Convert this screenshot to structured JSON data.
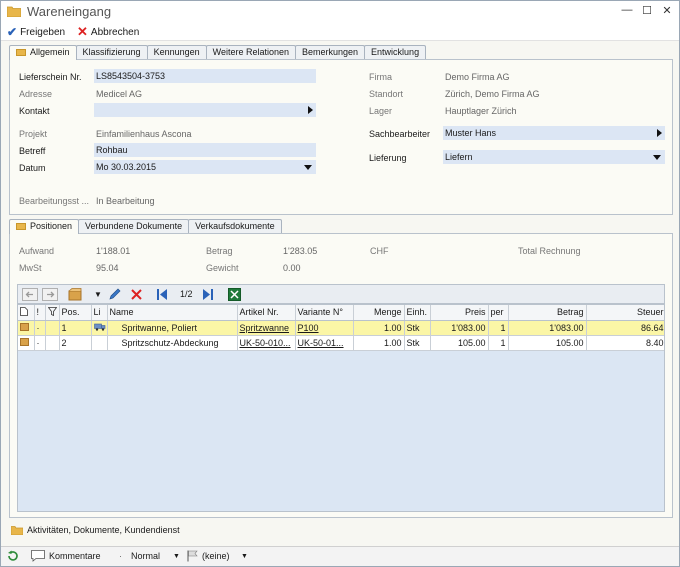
{
  "window": {
    "title": "Wareneingang",
    "controls": {
      "minimize": "—",
      "maximize": "☐",
      "close": "✕"
    }
  },
  "toolbar": {
    "approve_label": "Freigeben",
    "cancel_label": "Abbrechen"
  },
  "top_tabs": [
    "Allgemein",
    "Klassifizierung",
    "Kennungen",
    "Weitere Relationen",
    "Bemerkungen",
    "Entwicklung"
  ],
  "general": {
    "lieferschein_label": "Lieferschein Nr.",
    "lieferschein_value": "LS8543504-3753",
    "adresse_label": "Adresse",
    "adresse_value": "Medicel AG",
    "kontakt_label": "Kontakt",
    "kontakt_value": "",
    "projekt_label": "Projekt",
    "projekt_value": "Einfamilienhaus Ascona",
    "betreff_label": "Betreff",
    "betreff_value": "Rohbau",
    "datum_label": "Datum",
    "datum_value": "Mo 30.03.2015",
    "status_label": "Bearbeitungsst ...",
    "status_value": "In Bearbeitung",
    "firma_label": "Firma",
    "firma_value": "Demo Firma AG",
    "standort_label": "Standort",
    "standort_value": "Zürich, Demo Firma AG",
    "lager_label": "Lager",
    "lager_value": "Hauptlager Zürich",
    "sachbearbeiter_label": "Sachbearbeiter",
    "sachbearbeiter_value": "Muster Hans",
    "lieferung_label": "Lieferung",
    "lieferung_value": "Liefern"
  },
  "bottom_tabs": [
    "Positionen",
    "Verbundene Dokumente",
    "Verkaufsdokumente"
  ],
  "summary": {
    "aufwand_label": "Aufwand",
    "aufwand_value": "1'188.01",
    "mwst_label": "MwSt",
    "mwst_value": "95.04",
    "betrag_label": "Betrag",
    "betrag_value": "1'283.05",
    "currency": "CHF",
    "gewicht_label": "Gewicht",
    "gewicht_value": "0.00",
    "total_label": "Total Rechnung"
  },
  "grid_toolbar": {
    "page": "1/2"
  },
  "table": {
    "headers": [
      "",
      "!",
      "",
      "Pos.",
      "Li",
      "Name",
      "Artikel Nr.",
      "Variante N°",
      "Menge",
      "Einh.",
      "Preis",
      "per",
      "Betrag",
      "Steuer"
    ],
    "rows": [
      {
        "flag": "·",
        "pos": "1",
        "name": "Spritwanne, Poliert",
        "artikel": "Spritzwanne",
        "variante": "P100",
        "menge": "1.00",
        "einh": "Stk",
        "preis": "1'083.00",
        "per": "1",
        "betrag": "1'083.00",
        "steuer": "86.64"
      },
      {
        "flag": "·",
        "pos": "2",
        "name": "Spritzschutz-Abdeckung",
        "artikel": "UK-50-010...",
        "variante": "UK-50-01...",
        "menge": "1.00",
        "einh": "Stk",
        "preis": "105.00",
        "per": "1",
        "betrag": "105.00",
        "steuer": "8.40"
      }
    ]
  },
  "footer": {
    "activities_label": "Aktivitäten, Dokumente, Kundendienst"
  },
  "statusbar": {
    "comments_label": "Kommentare",
    "priority_value": "Normal",
    "flag_value": "(keine)"
  },
  "colors": {
    "field_bg": "#dce6f4",
    "selected_row": "#fbf6a6",
    "accent_blue": "#2a62b8",
    "cancel_red": "#dd2222"
  }
}
